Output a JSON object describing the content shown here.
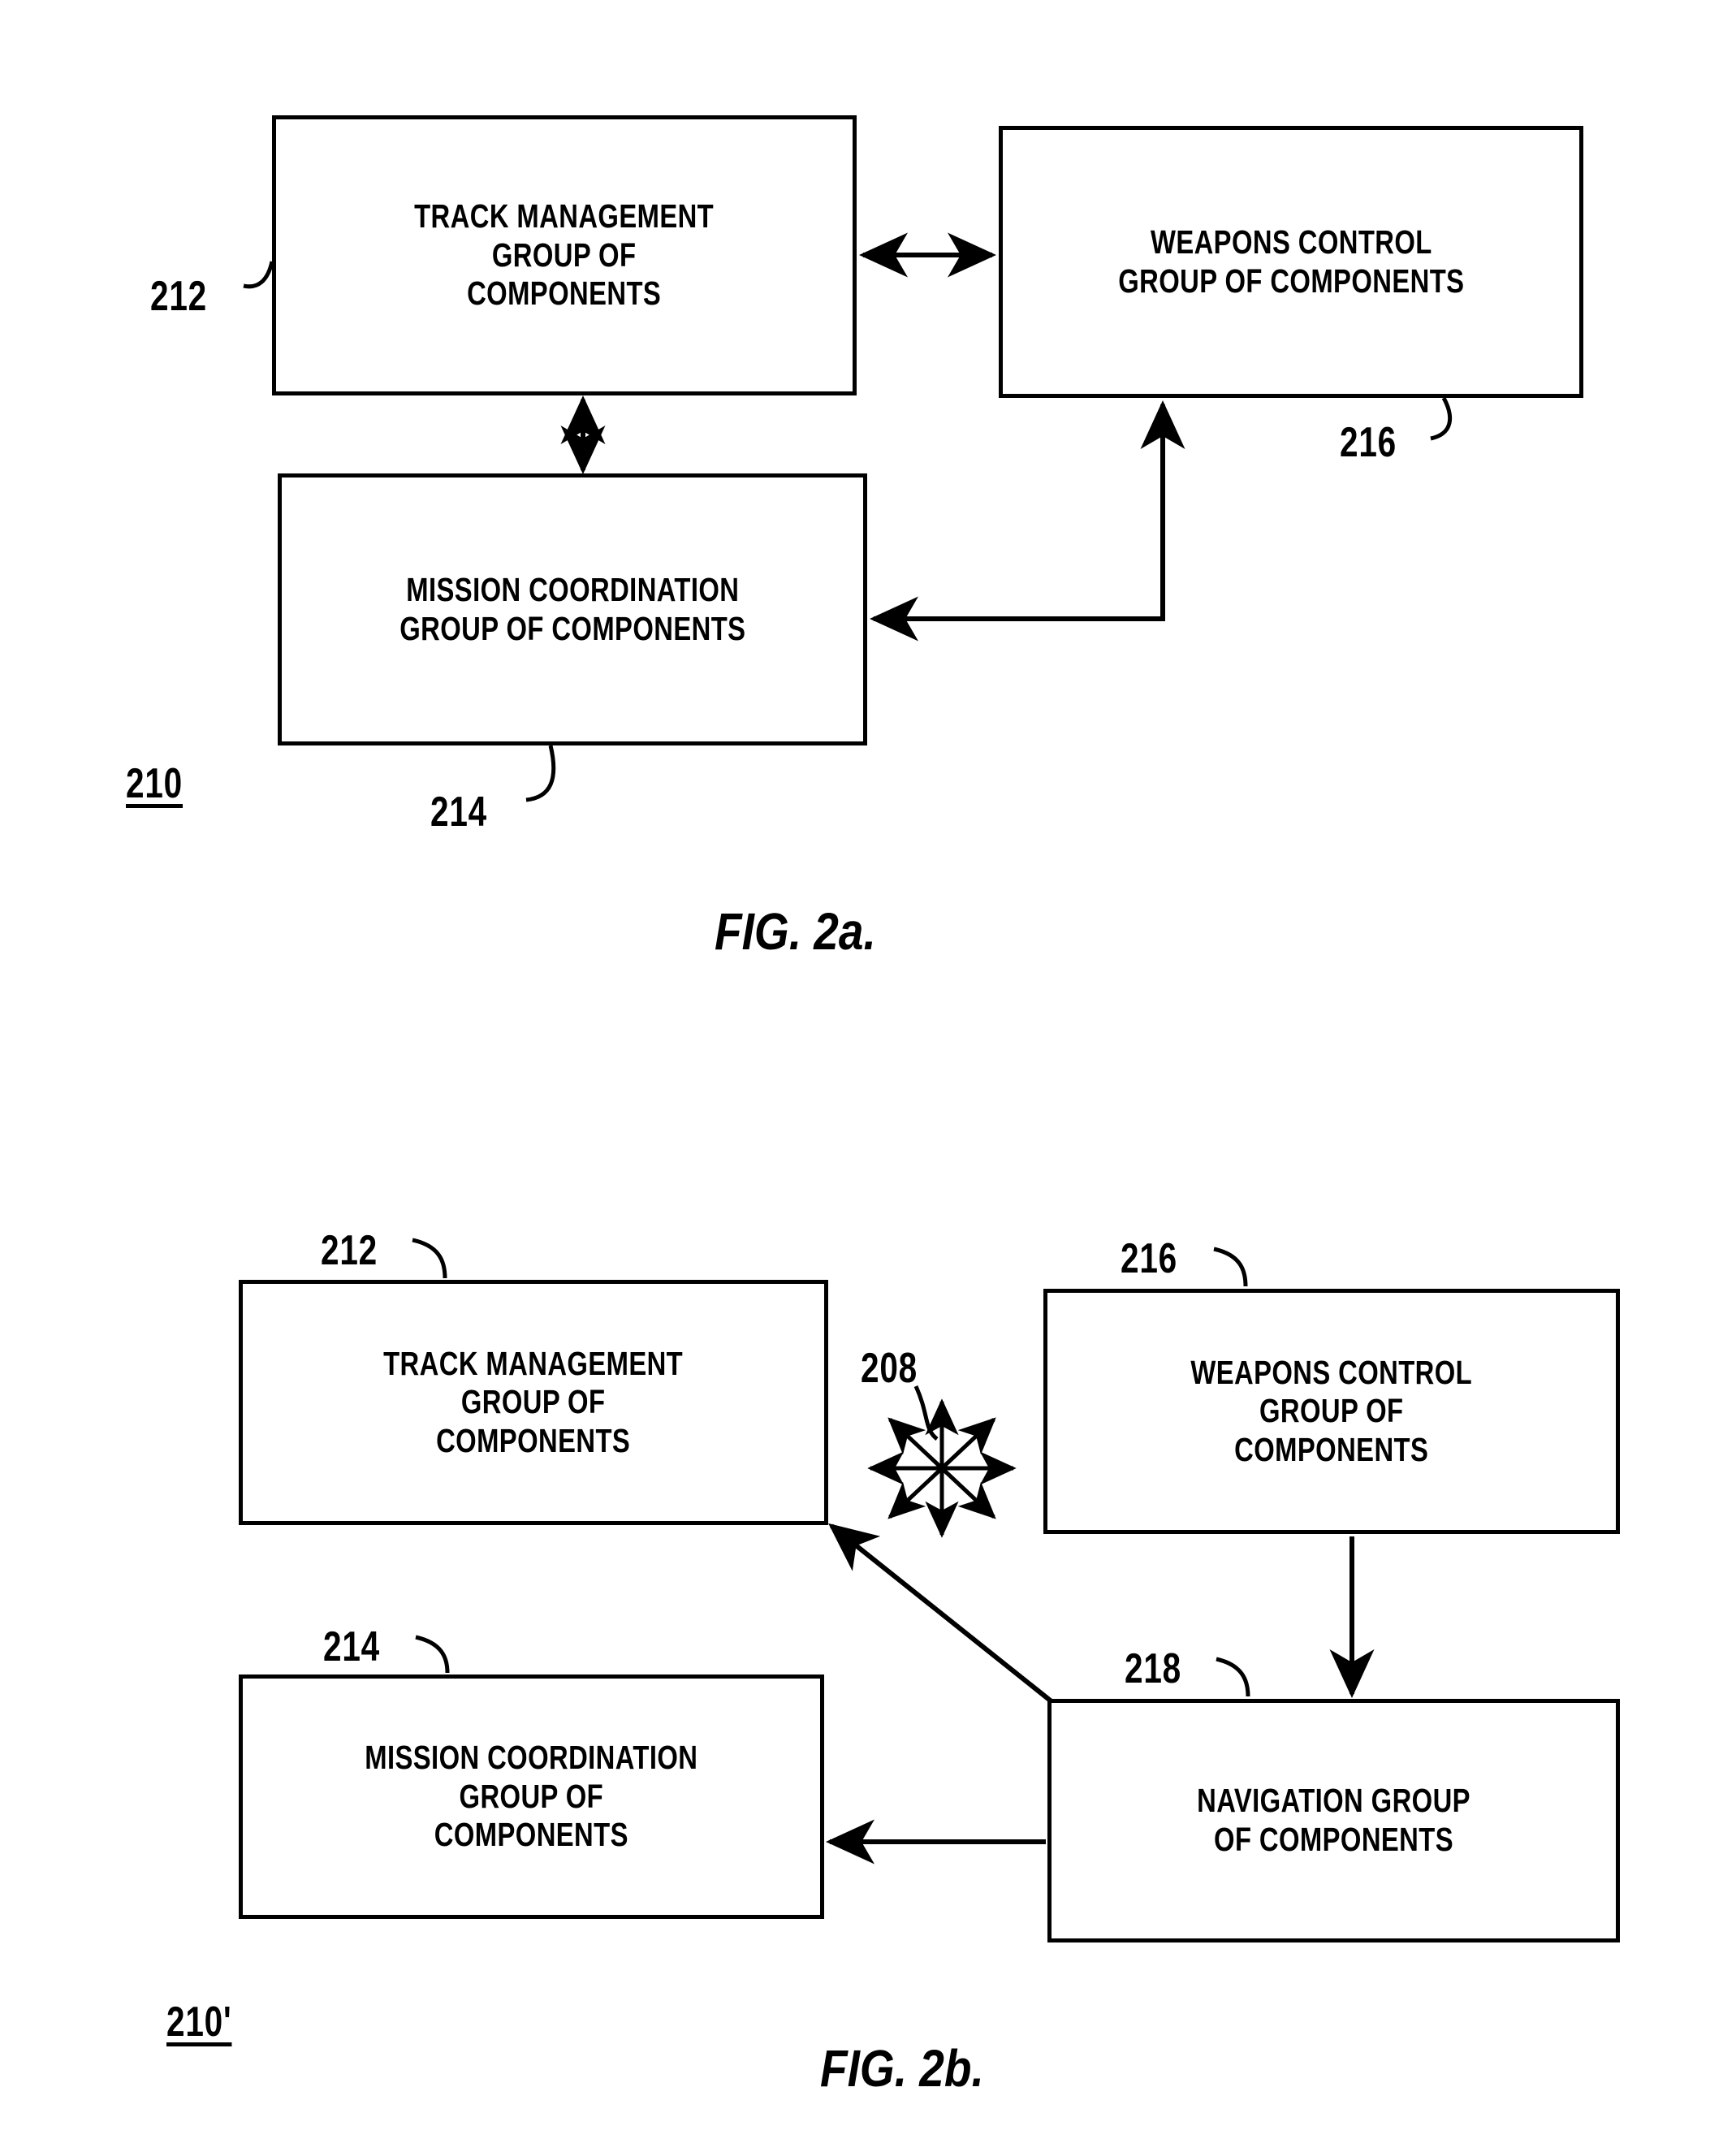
{
  "document": {
    "type": "patent-figure-sheet",
    "figures": [
      {
        "id": "fig2a",
        "caption": "FIG. 2a.",
        "system_ref": "210",
        "boxes": [
          {
            "ref": "212",
            "label": "TRACK MANAGEMENT\nGROUP OF\nCOMPONENTS"
          },
          {
            "ref": "216",
            "label": "WEAPONS CONTROL\nGROUP OF COMPONENTS"
          },
          {
            "ref": "214",
            "label": "MISSION COORDINATION\nGROUP OF COMPONENTS"
          }
        ],
        "connectors": [
          {
            "name": "track-to-weapons",
            "kind": "bidirectional-horizontal"
          },
          {
            "name": "track-to-mission",
            "kind": "bidirectional-vertical"
          },
          {
            "name": "weapons-to-mission",
            "kind": "elbow-double-arrow"
          }
        ]
      },
      {
        "id": "fig2b",
        "caption": "FIG. 2b.",
        "system_ref": "210'",
        "bus_ref": "208",
        "boxes": [
          {
            "ref": "212",
            "label": "TRACK MANAGEMENT\nGROUP OF\nCOMPONENTS"
          },
          {
            "ref": "216",
            "label": "WEAPONS CONTROL\nGROUP OF\nCOMPONENTS"
          },
          {
            "ref": "214",
            "label": "MISSION COORDINATION\nGROUP OF\nCOMPONENTS"
          },
          {
            "ref": "218",
            "label": "NAVIGATION GROUP\nOF COMPONENTS"
          }
        ],
        "connectors": [
          {
            "name": "eight-way-burst",
            "kind": "eight-direction-arrow-star"
          },
          {
            "name": "weapons-to-navigation",
            "kind": "arrow-down"
          },
          {
            "name": "navigation-to-mission",
            "kind": "arrow-left"
          },
          {
            "name": "navigation-to-track",
            "kind": "diagonal-arrow-up-left"
          }
        ]
      }
    ],
    "colors": {
      "ink": "#000000",
      "paper": "#ffffff"
    }
  }
}
